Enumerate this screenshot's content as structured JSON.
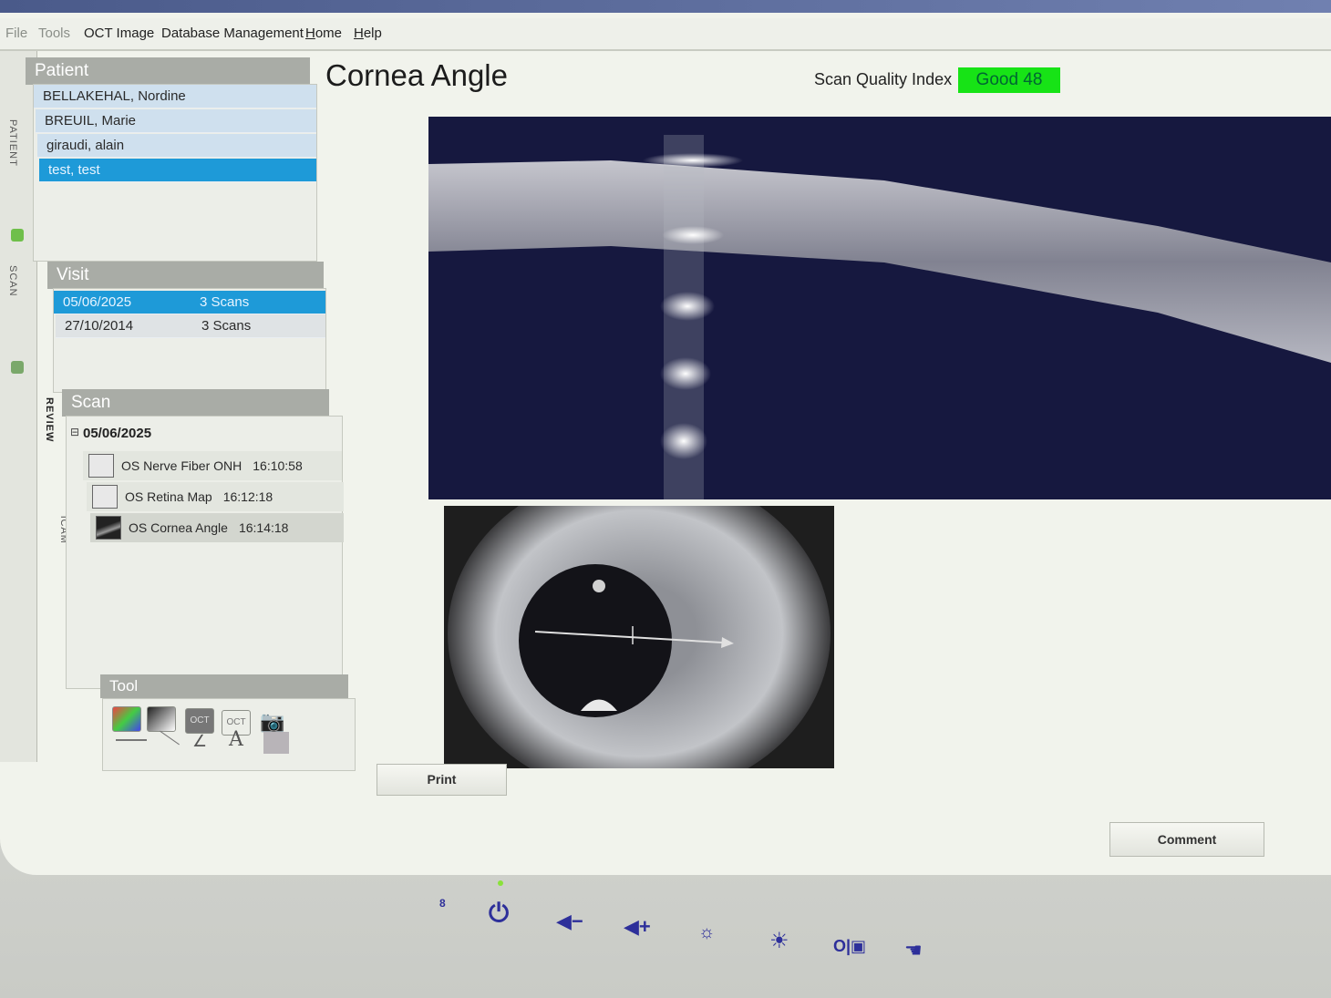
{
  "menu": {
    "items": [
      {
        "label": "File",
        "dim": true
      },
      {
        "label": "Tools",
        "dim": true
      },
      {
        "label": "OCT Image"
      },
      {
        "label": "Database Management"
      },
      {
        "label": "Home"
      },
      {
        "label": "Help"
      }
    ]
  },
  "sidetabs": [
    "PATIENT",
    "SCAN",
    "REVIEW",
    "iCAM"
  ],
  "patient": {
    "header": "Patient",
    "items": [
      "BELLAKEHAL, Nordine",
      "BREUIL, Marie",
      "giraudi, alain",
      "test, test"
    ],
    "selected_index": 3
  },
  "visit": {
    "header": "Visit",
    "items": [
      {
        "date": "05/06/2025",
        "scans": "3 Scans",
        "selected": true
      },
      {
        "date": "27/10/2014",
        "scans": "3 Scans",
        "selected": false
      }
    ]
  },
  "scan": {
    "header": "Scan",
    "date": "05/06/2025",
    "items": [
      {
        "label": "OS Nerve Fiber ONH",
        "time": "16:10:58"
      },
      {
        "label": "OS Retina Map",
        "time": "16:12:18"
      },
      {
        "label": "OS Cornea Angle",
        "time": "16:14:18"
      }
    ]
  },
  "tool": {
    "header": "Tool",
    "buttons": [
      "OCT",
      "OCT"
    ],
    "text_tool": "A"
  },
  "main": {
    "title": "Cornea Angle",
    "sqi_label": "Scan Quality Index",
    "sqi_value": "Good  48",
    "print_label": "Print",
    "comment_label": "Comment"
  },
  "colors": {
    "selected": "#1e9ad8",
    "sqi_good": "#17e316",
    "hardware_icons": "#2d2f9a"
  },
  "hardware_buttons": [
    "power-icon",
    "volume-down-icon",
    "volume-up-icon",
    "brightness-down-icon",
    "brightness-up-icon",
    "input-switch-icon",
    "hand-icon"
  ]
}
